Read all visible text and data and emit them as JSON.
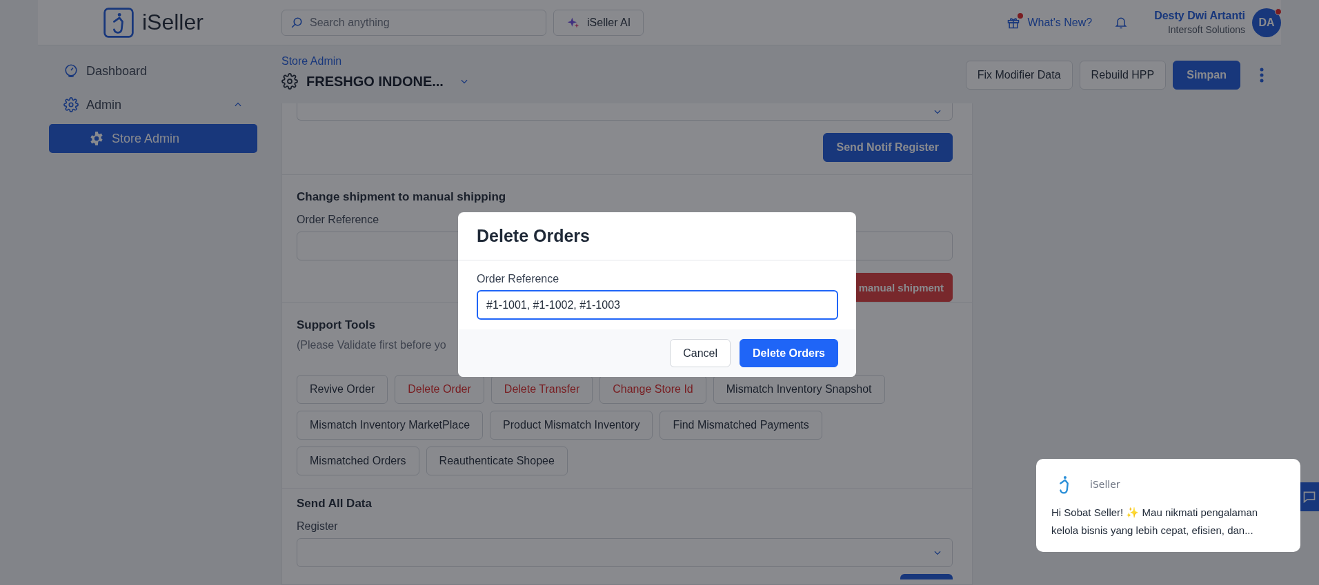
{
  "header": {
    "logo_text": "iSeller",
    "search": {
      "placeholder": "Search anything"
    },
    "ai_button": "iSeller AI",
    "whats_new": {
      "label": "What's New?",
      "unread": true
    },
    "user": {
      "name": "Desty Dwi Artanti",
      "company": "Intersoft Solutions",
      "initials": "DA",
      "unread": true
    }
  },
  "sidebar": {
    "items": [
      {
        "label": "Dashboard",
        "selected": false
      },
      {
        "label": "Admin",
        "selected": false,
        "expanded": true,
        "children": [
          {
            "label": "Store Admin",
            "selected": true
          }
        ]
      }
    ]
  },
  "page": {
    "breadcrumb": "Store Admin",
    "store_name": "FRESHGO INDONE...",
    "actions": [
      {
        "label": "Fix Modifier Data",
        "kind": "secondary"
      },
      {
        "label": "Rebuild HPP",
        "kind": "secondary"
      },
      {
        "label": "Simpan",
        "kind": "primary"
      }
    ]
  },
  "sections": [
    {
      "kind": "notif",
      "button": "Send Notif Register"
    },
    {
      "kind": "shipping",
      "title": "Change shipment to manual shipping",
      "field_label": "Order Reference",
      "button": "manual shipment"
    },
    {
      "kind": "tools",
      "title": "Support Tools",
      "note": "(Please Validate first before yo",
      "tools": [
        {
          "label": "Revive Order",
          "danger": false
        },
        {
          "label": "Delete Order",
          "danger": true
        },
        {
          "label": "Delete Transfer",
          "danger": true
        },
        {
          "label": "Change Store Id",
          "danger": true
        },
        {
          "label": "Mismatch Inventory Snapshot",
          "danger": false
        },
        {
          "label": "Mismatch Inventory MarketPlace",
          "danger": false
        },
        {
          "label": "Product Mismatch Inventory",
          "danger": false
        },
        {
          "label": "Find Mismatched Payments",
          "danger": false
        },
        {
          "label": "Mismatched Orders",
          "danger": false
        },
        {
          "label": "Reauthenticate Shopee",
          "danger": false
        }
      ]
    },
    {
      "kind": "send_all",
      "title": "Send All Data",
      "field_label": "Register"
    }
  ],
  "modal": {
    "title": "Delete Orders",
    "field_label": "Order Reference",
    "value": "#1-1001, #1-1002, #1-1003",
    "buttons": [
      {
        "label": "Cancel",
        "kind": "secondary"
      },
      {
        "label": "Delete Orders",
        "kind": "primary"
      }
    ]
  },
  "chat": {
    "sender": "iSeller",
    "message": "Hi Sobat Seller! ✨ Mau nikmati pengalaman kelola bisnis yang lebih cepat, efisien, dan..."
  }
}
